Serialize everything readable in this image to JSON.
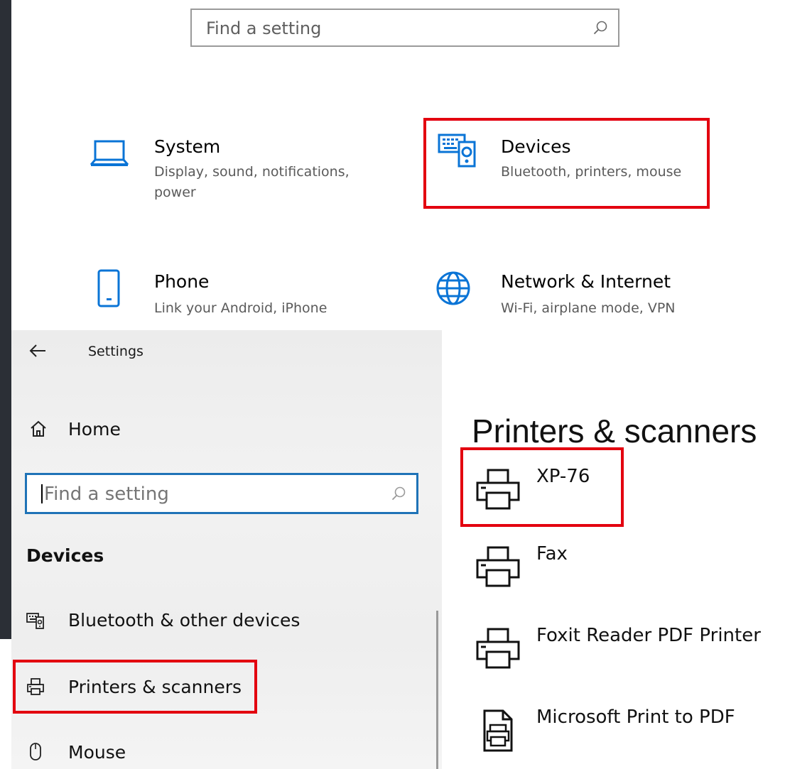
{
  "search_top": {
    "placeholder": "Find a setting"
  },
  "tiles": [
    {
      "title": "System",
      "description": "Display, sound, notifications, power",
      "icon": "laptop-icon"
    },
    {
      "title": "Devices",
      "description": "Bluetooth, printers, mouse",
      "icon": "devices-icon"
    },
    {
      "title": "Phone",
      "description": "Link your Android, iPhone",
      "icon": "phone-icon"
    },
    {
      "title": "Network & Internet",
      "description": "Wi-Fi, airplane mode, VPN",
      "icon": "globe-icon"
    }
  ],
  "window": {
    "title": "Settings"
  },
  "nav": {
    "home_label": "Home",
    "search_placeholder": "Find a setting",
    "section_heading": "Devices",
    "items": [
      {
        "label": "Bluetooth & other devices",
        "icon": "bluetooth-devices-icon"
      },
      {
        "label": "Printers & scanners",
        "icon": "printer-icon"
      },
      {
        "label": "Mouse",
        "icon": "mouse-icon"
      }
    ]
  },
  "page": {
    "title": "Printers & scanners",
    "printers": [
      {
        "name": "XP-76",
        "icon": "printer-icon"
      },
      {
        "name": "Fax",
        "icon": "printer-icon"
      },
      {
        "name": "Foxit Reader PDF Printer",
        "icon": "printer-icon"
      },
      {
        "name": "Microsoft Print to PDF",
        "icon": "pdf-printer-icon"
      }
    ]
  },
  "colors": {
    "accent_blue": "#0a74d6",
    "highlight_red": "#e3000f",
    "focus_border": "#1f73b7"
  }
}
